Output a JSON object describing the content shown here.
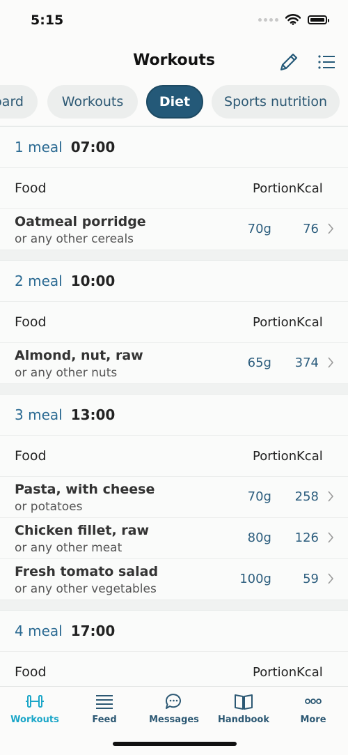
{
  "status_bar": {
    "time": "5:15"
  },
  "header": {
    "title": "Workouts"
  },
  "tabs": [
    {
      "label": "Dashboard"
    },
    {
      "label": "Workouts"
    },
    {
      "label": "Diet"
    },
    {
      "label": "Sports nutrition"
    }
  ],
  "columns": {
    "food": "Food",
    "portion": "Portion",
    "kcal": "Kcal"
  },
  "meals": [
    {
      "number": "1 meal",
      "time": "07:00",
      "items": [
        {
          "name": "Oatmeal porridge",
          "alt": "or any other cereals",
          "portion": "70g",
          "kcal": "76"
        }
      ]
    },
    {
      "number": "2 meal",
      "time": "10:00",
      "items": [
        {
          "name": "Almond, nut, raw",
          "alt": "or any other nuts",
          "portion": "65g",
          "kcal": "374"
        }
      ]
    },
    {
      "number": "3 meal",
      "time": "13:00",
      "items": [
        {
          "name": "Pasta, with cheese",
          "alt": "or potatoes",
          "portion": "70g",
          "kcal": "258"
        },
        {
          "name": "Chicken fillet, raw",
          "alt": "or any other meat",
          "portion": "80g",
          "kcal": "126"
        },
        {
          "name": "Fresh tomato salad",
          "alt": "or any other vegetables",
          "portion": "100g",
          "kcal": "59"
        }
      ]
    },
    {
      "number": "4 meal",
      "time": "17:00",
      "items": []
    }
  ],
  "tabbar": [
    {
      "label": "Workouts",
      "icon": "dumbbell-icon",
      "active": true
    },
    {
      "label": "Feed",
      "icon": "feed-lines-icon",
      "active": false
    },
    {
      "label": "Messages",
      "icon": "chat-bubbles-icon",
      "active": false
    },
    {
      "label": "Handbook",
      "icon": "book-icon",
      "active": false
    },
    {
      "label": "More",
      "icon": "more-dots-icon",
      "active": false
    }
  ],
  "colors": {
    "accent": "#245978",
    "active_tab": "#1ba6c8",
    "value_text": "#2d5e7e",
    "meal_label": "#2b6a92"
  }
}
